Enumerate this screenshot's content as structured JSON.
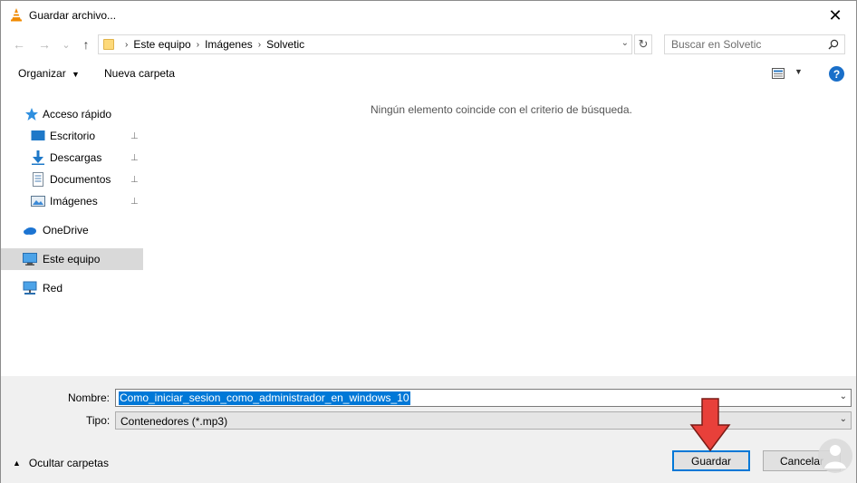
{
  "window": {
    "title": "Guardar archivo...",
    "close_glyph": "✕",
    "title_icon": "vlc-cone-icon"
  },
  "nav": {
    "back_glyph": "←",
    "forward_glyph": "→",
    "recent_glyph": "⌄",
    "up_glyph": "↑",
    "breadcrumb": [
      "Este equipo",
      "Imágenes",
      "Solvetic"
    ],
    "separator": "›",
    "refresh_glyph": "↻",
    "search_placeholder": "Buscar en Solvetic"
  },
  "toolbar": {
    "organize_label": "Organizar",
    "new_folder_label": "Nueva carpeta",
    "help_glyph": "?"
  },
  "sidebar": {
    "quick_access": "Acceso rápido",
    "items": [
      {
        "label": "Escritorio",
        "icon": "desktop-icon"
      },
      {
        "label": "Descargas",
        "icon": "download-icon"
      },
      {
        "label": "Documentos",
        "icon": "document-icon"
      },
      {
        "label": "Imágenes",
        "icon": "pictures-icon"
      }
    ],
    "onedrive": "OneDrive",
    "this_pc": "Este equipo",
    "network": "Red",
    "pin_glyph": "📌"
  },
  "content": {
    "empty_message": "Ningún elemento coincide con el criterio de búsqueda."
  },
  "form": {
    "name_label": "Nombre:",
    "name_value": "Como_iniciar_sesion_como_administrador_en_windows_10",
    "type_label": "Tipo:",
    "type_value": "Contenedores (*.mp3)",
    "dropdown_glyph": "⌄",
    "hide_folders_label": "Ocultar carpetas",
    "save_label": "Guardar",
    "cancel_label": "Cancelar"
  },
  "colors": {
    "accent": "#0078d7",
    "arrow_red": "#e8403a",
    "selection_bg": "#d9d9d9",
    "footer_bg": "#f0f0f0"
  }
}
